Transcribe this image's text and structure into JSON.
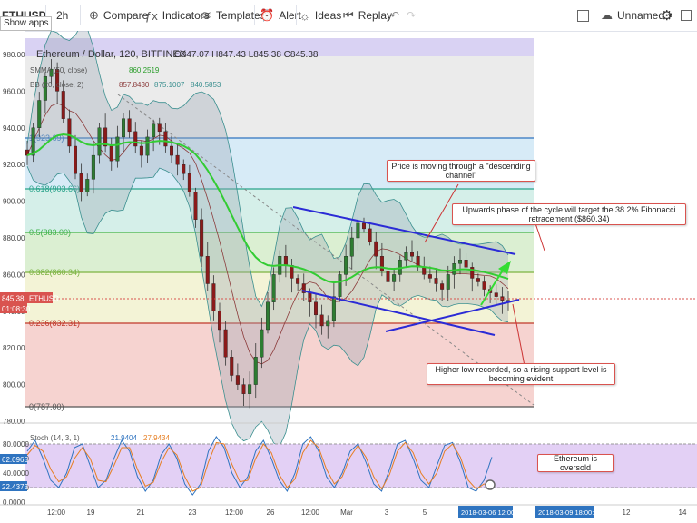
{
  "toolbar": {
    "symbol": "ETHUSD",
    "interval": "2h",
    "compare": "Compare",
    "indicators": "Indicators",
    "templates": "Templates",
    "alert": "Alert",
    "ideas": "Ideas",
    "replay": "Replay",
    "layout_name": "Unnamed",
    "show_apps": "Show apps"
  },
  "legend": {
    "title": "Ethereum / Dollar, 120, BITFINEX",
    "ohlc": "O847.07  H847.43  L845.38  C845.38",
    "smma_label": "SMMA (50, close)",
    "smma_value": "860.2519",
    "bb_label": "BB (20, close, 2)",
    "bb_values": [
      "857.8430",
      "875.1007",
      "840.5853"
    ],
    "stoch_label": "Stoch (14, 3, 1)",
    "stoch_values": [
      "21.9404",
      "27.9434"
    ]
  },
  "price_axis": {
    "ticks": [
      "980.00",
      "960.00",
      "940.00",
      "920.00",
      "900.00",
      "880.00",
      "860.00",
      "840.00",
      "820.00",
      "800.00",
      "780.00"
    ],
    "current_price": "845.38",
    "current_symbol": "ETHUSD",
    "countdown": "01:08:30"
  },
  "fib_levels": [
    {
      "label": "1(923.69)",
      "color": "#2f74c0"
    },
    {
      "label": "0.618(903.66)",
      "color": "#29a38a"
    },
    {
      "label": "0.5(883.00)",
      "color": "#41b24c"
    },
    {
      "label": "0.382(860.34)",
      "color": "#7cb342"
    },
    {
      "label": "0.236(832.31)",
      "color": "#c0392b"
    },
    {
      "label": "0(787.00)",
      "color": "#555555"
    }
  ],
  "stoch_axis": {
    "ticks": [
      "80.0000",
      "60.0000",
      "40.0000",
      "20.0000",
      "0.0000"
    ],
    "k_value": "62.0965",
    "d_value": "22.4373"
  },
  "time_axis": {
    "ticks": [
      "12:00",
      "19",
      "21",
      "23",
      "12:00",
      "26",
      "12:00",
      "Mar",
      "3",
      "5",
      "7",
      "9",
      "12",
      "14"
    ],
    "cursor_labels": [
      "2018-03-06 12:00:00",
      "2018-03-09 18:00:00"
    ]
  },
  "annotations": {
    "channel": "Price is moving through a \"descending channel\"",
    "target": "Upwards phase of the cycle will target the 38.2% Fibonacci retracement ($860.34)",
    "support": "Higher low recorded, so a rising support level is becoming evident",
    "oversold": "Ethereum is oversold"
  },
  "chart_data": [
    {
      "type": "candlestick",
      "title": "Ethereum / Dollar, 120, BITFINEX",
      "ylim": [
        775,
        990
      ],
      "y_axis": "right",
      "close_series": [
        925,
        940,
        955,
        968,
        972,
        960,
        945,
        930,
        915,
        905,
        912,
        925,
        940,
        930,
        922,
        935,
        945,
        938,
        930,
        925,
        935,
        942,
        938,
        930,
        925,
        920,
        915,
        905,
        890,
        870,
        855,
        840,
        830,
        815,
        805,
        800,
        795,
        800,
        815,
        830,
        845,
        860,
        870,
        865,
        858,
        855,
        850,
        845,
        838,
        832,
        835,
        848,
        860,
        870,
        880,
        888,
        885,
        878,
        870,
        862,
        856,
        860,
        868,
        872,
        870,
        864,
        860,
        858,
        855,
        852,
        860,
        866,
        868,
        864,
        858,
        856,
        852,
        850,
        848,
        846,
        845
      ]
    },
    {
      "type": "line",
      "title": "Stoch (14, 3, 1)",
      "ylim": [
        0,
        100
      ],
      "series": [
        {
          "name": "%K",
          "values": [
            70,
            85,
            60,
            30,
            20,
            40,
            75,
            80,
            50,
            20,
            30,
            60,
            85,
            70,
            35,
            15,
            30,
            65,
            80,
            60,
            25,
            10,
            25,
            70,
            90,
            75,
            40,
            20,
            35,
            70,
            85,
            60,
            30,
            15,
            40,
            80,
            90,
            70,
            35,
            20,
            40,
            70,
            80,
            55,
            25,
            15,
            45,
            80,
            85,
            60,
            30,
            20,
            50,
            78,
            82,
            55,
            20,
            15,
            30,
            62
          ]
        },
        {
          "name": "%D",
          "values": [
            65,
            78,
            70,
            45,
            28,
            35,
            60,
            75,
            60,
            30,
            28,
            50,
            75,
            75,
            45,
            22,
            27,
            55,
            75,
            65,
            35,
            15,
            20,
            55,
            82,
            80,
            52,
            28,
            30,
            60,
            80,
            68,
            38,
            20,
            32,
            68,
            85,
            75,
            45,
            25,
            35,
            62,
            78,
            62,
            35,
            18,
            38,
            70,
            82,
            68,
            40,
            25,
            40,
            70,
            80,
            62,
            30,
            18,
            25,
            22
          ]
        }
      ],
      "levels": [
        80,
        20
      ]
    }
  ]
}
